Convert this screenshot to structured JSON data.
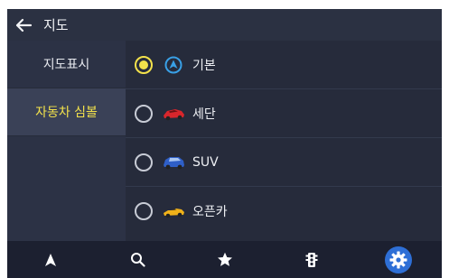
{
  "header": {
    "back_icon": "back-arrow-icon",
    "title": "지도"
  },
  "sidebar": {
    "items": [
      {
        "label": "지도표시",
        "active": false
      },
      {
        "label": "자동차 심볼",
        "active": true
      }
    ]
  },
  "options": [
    {
      "label": "기본",
      "icon": "navigation-arrow-icon",
      "selected": true
    },
    {
      "label": "세단",
      "icon": "red-sedan-icon",
      "selected": false
    },
    {
      "label": "SUV",
      "icon": "blue-suv-icon",
      "selected": false
    },
    {
      "label": "오픈카",
      "icon": "yellow-convertible-icon",
      "selected": false
    }
  ],
  "bottom_bar": {
    "tabs": [
      "navigate-icon",
      "search-icon",
      "favorites-star-icon",
      "traffic-light-icon",
      "settings-gear-icon"
    ]
  },
  "colors": {
    "accent": "#f3e24b",
    "selected_blue": "#2e6fd6"
  }
}
